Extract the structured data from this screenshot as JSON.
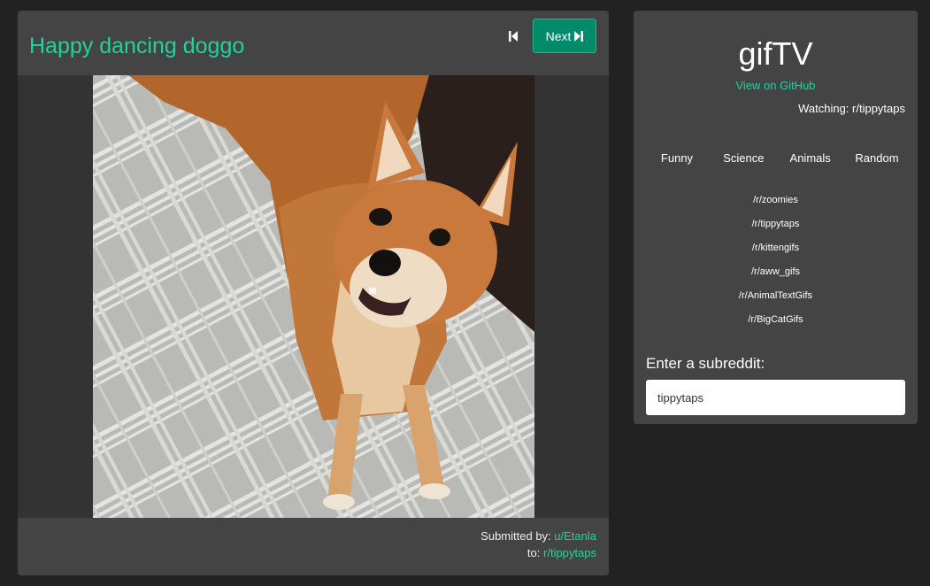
{
  "viewer": {
    "title": "Happy dancing doggo",
    "prev_icon": "skip-back-icon",
    "next_label": "Next",
    "next_icon": "skip-forward-icon",
    "gif_alt": "Shiba Inu dog dancing on a plaid rug",
    "footer": {
      "submitted_by_label": "Submitted by:",
      "author": "u/Etanla",
      "to_label": "to:",
      "subreddit": "r/tippytaps"
    }
  },
  "panel": {
    "app_title": "gifTV",
    "github_link": "View on GitHub",
    "watching": "Watching: r/tippytaps",
    "categories": [
      "Funny",
      "Science",
      "Animals",
      "Random"
    ],
    "subreddits": [
      "/r/zoomies",
      "/r/tippytaps",
      "/r/kittengifs",
      "/r/aww_gifs",
      "/r/AnimalTextGifs",
      "/r/BigCatGifs"
    ],
    "input_label": "Enter a subreddit:",
    "input_value": "tippytaps"
  },
  "colors": {
    "accent": "#1fd3a0",
    "button": "#008c6a",
    "background": "#222222",
    "panel": "#444444"
  }
}
